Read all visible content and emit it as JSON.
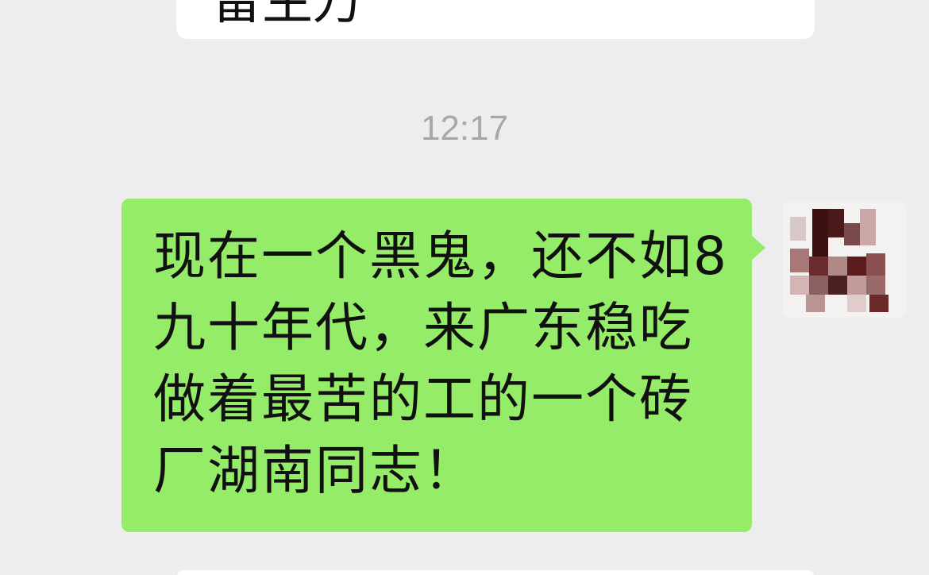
{
  "chat": {
    "incoming_partial_text": "留生万",
    "timestamp": "12:17",
    "outgoing_message": "现在一个黑鬼，还不如8九十年代，来广东稳吃做着最苦的工的一个砖厂湖南同志！",
    "avatar_icon": "pixelated-avatar-icon"
  },
  "colors": {
    "background": "#ededed",
    "outgoing_bubble": "#95ec69",
    "incoming_bubble": "#ffffff",
    "timestamp_text": "#a8a8a8"
  }
}
